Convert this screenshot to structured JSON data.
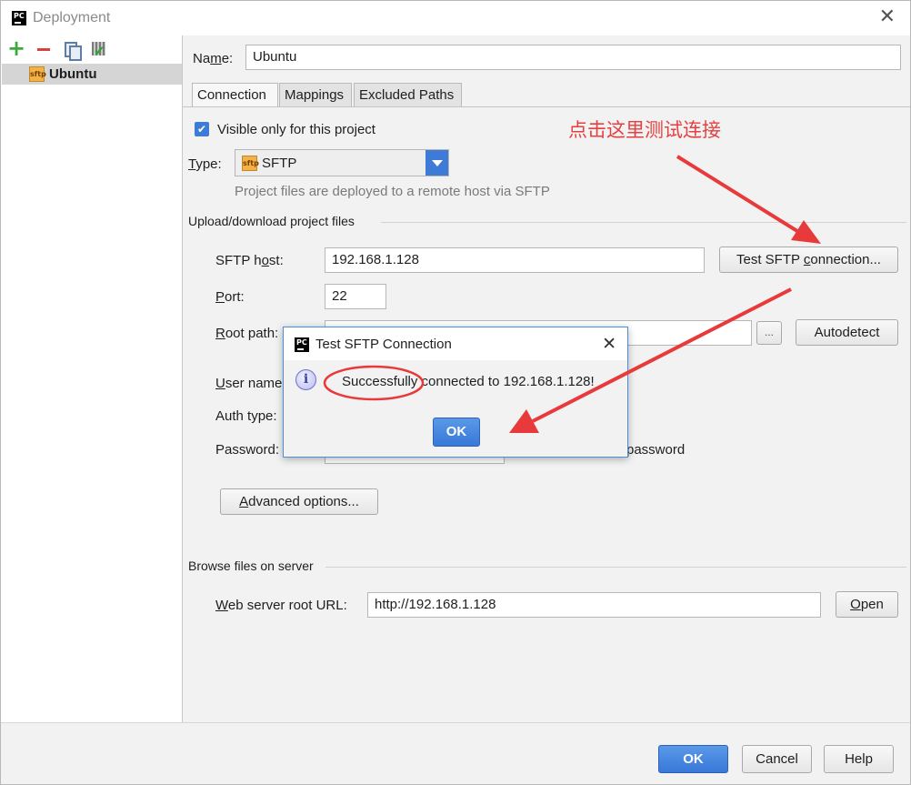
{
  "window": {
    "title": "Deployment",
    "app_icon": "pycharm-icon",
    "close_icon": "close-icon"
  },
  "sidebar": {
    "toolbar": [
      "add-icon",
      "remove-icon",
      "copy-icon",
      "set-default-icon"
    ],
    "items": [
      {
        "label": "Ubuntu",
        "icon": "sftp-server-icon",
        "selected": true
      }
    ]
  },
  "form": {
    "name_label": "Name:",
    "name_value": "Ubuntu",
    "tabs": [
      {
        "label": "Connection",
        "active": true
      },
      {
        "label": "Mappings",
        "active": false
      },
      {
        "label": "Excluded Paths",
        "active": false
      }
    ],
    "visible_only_label": "Visible only for this project",
    "visible_only_checked": true,
    "type_label": "Type:",
    "type_value": "SFTP",
    "type_icon_text": "sftp",
    "type_hint": "Project files are deployed to a remote host via SFTP",
    "upload_section": "Upload/download project files",
    "sftp_host_label": "SFTP host:",
    "sftp_host_value": "192.168.1.128",
    "test_button": "Test SFTP connection...",
    "port_label": "Port:",
    "port_value": "22",
    "root_path_label": "Root path:",
    "root_path_value": "",
    "browse_button": "...",
    "autodetect_button": "Autodetect",
    "user_name_label": "User name:",
    "auth_type_label": "Auth type:",
    "password_label": "Password:",
    "save_password_label": "password",
    "advanced_button": "Advanced options...",
    "browse_section": "Browse files on server",
    "web_root_label": "Web server root URL:",
    "web_root_value": "http://192.168.1.128",
    "open_button": "Open"
  },
  "annotation": {
    "text": "点击这里测试连接",
    "color": "#e54040"
  },
  "footer": {
    "ok": "OK",
    "cancel": "Cancel",
    "help": "Help"
  },
  "dialog": {
    "title": "Test SFTP Connection",
    "message": "Successfully connected to 192.168.1.128!",
    "ok": "OK",
    "icon": "info-icon"
  },
  "colors": {
    "accent": "#3e7bd6",
    "annotation_red": "#e54040"
  }
}
